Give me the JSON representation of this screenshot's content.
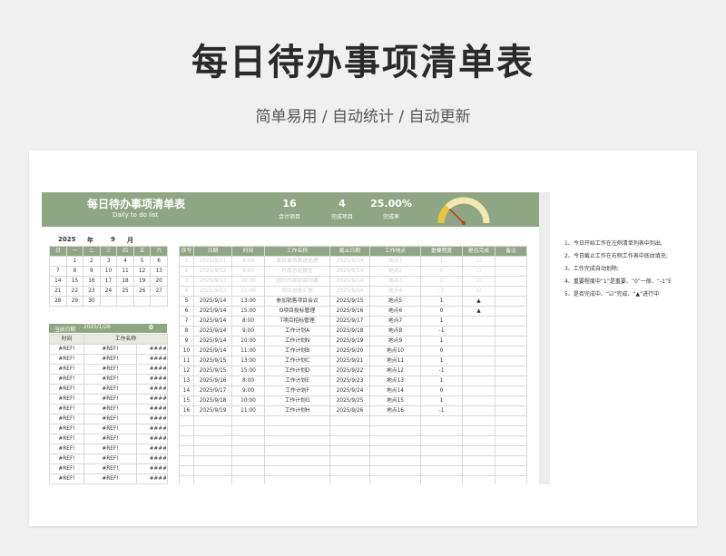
{
  "page": {
    "title": "每日待办事项清单表",
    "subtitle": "简单易用 / 自动统计 / 自动更新"
  },
  "banner": {
    "title": "每日待办事项清单表",
    "subtitle": "Daily to do list",
    "stats": [
      {
        "value": "16",
        "label": "合计项目"
      },
      {
        "value": "4",
        "label": "完成项目"
      },
      {
        "value": "25.00%",
        "label": "完成率"
      }
    ],
    "gauge_fraction": 0.25,
    "colors": {
      "accent": "#8fa684",
      "gauge_yellow": "#e9c53a",
      "gauge_needle": "#c0392b"
    }
  },
  "calendar": {
    "year": "2025",
    "year_label": "年",
    "month": "9",
    "month_label": "月",
    "weekdays": [
      "日",
      "一",
      "二",
      "三",
      "四",
      "五",
      "六"
    ],
    "weeks": [
      [
        "",
        "1",
        "2",
        "3",
        "4",
        "5",
        "6"
      ],
      [
        "7",
        "8",
        "9",
        "10",
        "11",
        "12",
        "13"
      ],
      [
        "14",
        "15",
        "16",
        "17",
        "18",
        "19",
        "20"
      ],
      [
        "21",
        "22",
        "23",
        "24",
        "25",
        "26",
        "27"
      ],
      [
        "28",
        "29",
        "30",
        "",
        "",
        "",
        ""
      ]
    ]
  },
  "today": {
    "label": "当前日期",
    "date": "2025/1/26",
    "count": "0"
  },
  "worklist": {
    "headers": [
      "时间",
      "工作名称"
    ],
    "rows": [
      [
        "#REF!",
        "#REF!",
        "####"
      ],
      [
        "#REF!",
        "#REF!",
        "####"
      ],
      [
        "#REF!",
        "#REF!",
        "####"
      ],
      [
        "#REF!",
        "#REF!",
        "####"
      ],
      [
        "#REF!",
        "#REF!",
        "####"
      ],
      [
        "#REF!",
        "#REF!",
        "####"
      ],
      [
        "#REF!",
        "#REF!",
        "####"
      ],
      [
        "#REF!",
        "#REF!",
        "####"
      ],
      [
        "#REF!",
        "#REF!",
        "####"
      ],
      [
        "#REF!",
        "#REF!",
        "####"
      ],
      [
        "#REF!",
        "#REF!",
        "####"
      ],
      [
        "#REF!",
        "#REF!",
        "####"
      ],
      [
        "#REF!",
        "#REF!",
        "####"
      ],
      [
        "#REF!",
        "#REF!",
        "####"
      ],
      [
        "#REF!",
        "#REF!",
        "####"
      ]
    ]
  },
  "tasks": {
    "headers": [
      "序号",
      "日期",
      "时间",
      "工作名称",
      "截止日期",
      "工作地点",
      "重要程度",
      "是否完成",
      "备注"
    ],
    "rows": [
      {
        "muted": true,
        "cells": [
          "1",
          "2025/9/11",
          "8:00",
          "紧急事项跟进处理",
          "2025/9/14",
          "地点1",
          "1",
          "☑",
          ""
        ]
      },
      {
        "muted": true,
        "cells": [
          "2",
          "2025/9/12",
          "9:00",
          "月度总结报告",
          "2025/9/14",
          "地点2",
          "0",
          "☑",
          ""
        ]
      },
      {
        "muted": true,
        "cells": [
          "3",
          "2025/9/13",
          "10:00",
          "团队内部协调沟通",
          "2025/9/14",
          "地点3",
          "1",
          "☑",
          ""
        ]
      },
      {
        "muted": true,
        "cells": [
          "4",
          "2025/9/13",
          "11:00",
          "项目进度汇报",
          "2025/9/14",
          "地点4",
          "-1",
          "☑",
          ""
        ]
      },
      {
        "muted": false,
        "cells": [
          "5",
          "2025/9/14",
          "13:00",
          "参加销售项目会议",
          "2025/9/15",
          "地点5",
          "1",
          "▲",
          ""
        ]
      },
      {
        "muted": false,
        "cells": [
          "6",
          "2025/9/14",
          "15:00",
          "D项目投标管理",
          "2025/9/16",
          "地点6",
          "0",
          "▲",
          ""
        ]
      },
      {
        "muted": false,
        "cells": [
          "7",
          "2025/9/14",
          "8:00",
          "T项目招标管理",
          "2025/9/17",
          "地点7",
          "1",
          "",
          ""
        ]
      },
      {
        "muted": false,
        "cells": [
          "8",
          "2025/9/14",
          "9:00",
          "工作计划A",
          "2025/9/18",
          "地点8",
          "-1",
          "",
          ""
        ]
      },
      {
        "muted": false,
        "cells": [
          "9",
          "2025/9/14",
          "10:00",
          "工作计划N",
          "2025/9/19",
          "地点9",
          "1",
          "",
          ""
        ]
      },
      {
        "muted": false,
        "cells": [
          "10",
          "2025/9/14",
          "11:00",
          "工作计划B",
          "2025/9/20",
          "地点10",
          "0",
          "",
          ""
        ]
      },
      {
        "muted": false,
        "cells": [
          "11",
          "2025/9/15",
          "13:00",
          "工作计划C",
          "2025/9/21",
          "地点11",
          "1",
          "",
          ""
        ]
      },
      {
        "muted": false,
        "cells": [
          "12",
          "2025/9/15",
          "15:00",
          "工作计划D",
          "2025/9/22",
          "地点12",
          "-1",
          "",
          ""
        ]
      },
      {
        "muted": false,
        "cells": [
          "13",
          "2025/9/16",
          "8:00",
          "工作计划E",
          "2025/9/23",
          "地点13",
          "1",
          "",
          ""
        ]
      },
      {
        "muted": false,
        "cells": [
          "14",
          "2025/9/17",
          "9:00",
          "工作计划F",
          "2025/9/24",
          "地点14",
          "0",
          "",
          ""
        ]
      },
      {
        "muted": false,
        "cells": [
          "15",
          "2025/9/18",
          "10:00",
          "工作计划G",
          "2025/9/25",
          "地点15",
          "1",
          "",
          ""
        ]
      },
      {
        "muted": false,
        "cells": [
          "16",
          "2025/9/19",
          "11:00",
          "工作计划H",
          "2025/9/26",
          "地点16",
          "-1",
          "",
          ""
        ]
      }
    ]
  },
  "notes": [
    "1、今日开始工作在左侧清单列表中列出;",
    "2、今日截止工作在右侧工作表中底纹填充;",
    "3、工作完成自动划除;",
    "4、重要程度中“1”是重要、“0”一般、“-1”E",
    "5、是否完成中、“☑”完成、“▲”进行中"
  ]
}
